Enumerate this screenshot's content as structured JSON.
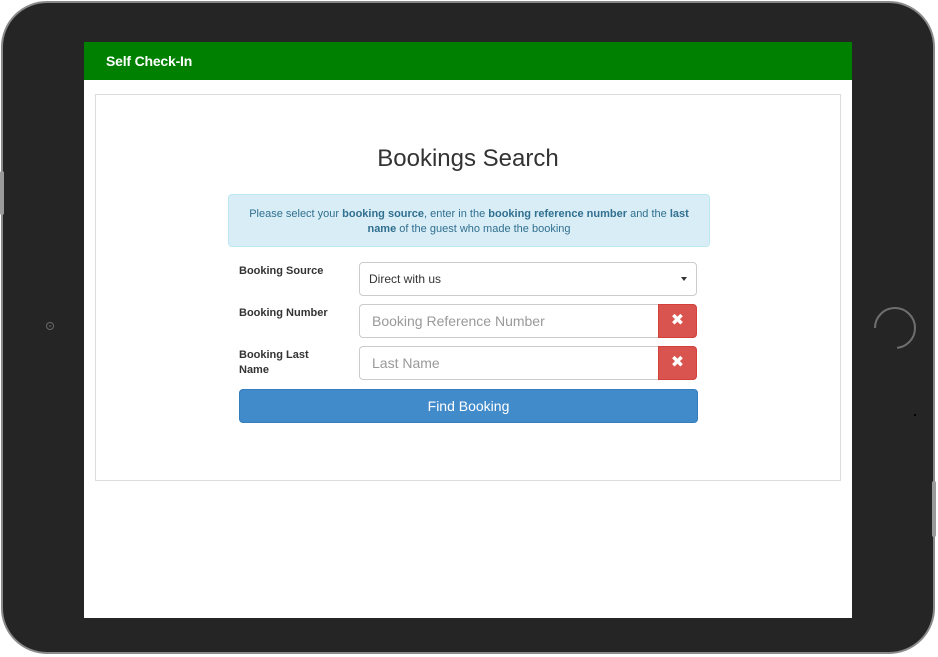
{
  "app": {
    "title": "Self Check-In"
  },
  "page": {
    "title": "Bookings Search"
  },
  "info": {
    "t1": "Please select your ",
    "b1": "booking source",
    "t2": ", enter in the ",
    "b2": "booking reference number",
    "t3": " and the ",
    "b3": "last name",
    "t4": " of the guest who made the booking"
  },
  "form": {
    "source": {
      "label": "Booking Source",
      "value": "Direct with us"
    },
    "number": {
      "label": "Booking Number",
      "placeholder": "Booking Reference Number",
      "value": ""
    },
    "lastname": {
      "label": "Booking Last Name",
      "placeholder": "Last Name",
      "value": ""
    },
    "clear_icon": "✖",
    "submit_label": "Find Booking"
  },
  "icons": {
    "clear": "times-icon",
    "dropdown": "caret-down-icon"
  },
  "colors": {
    "header": "#008000",
    "primary": "#428bca",
    "danger": "#d9534f",
    "info_bg": "#d9edf7",
    "info_text": "#31708f"
  }
}
